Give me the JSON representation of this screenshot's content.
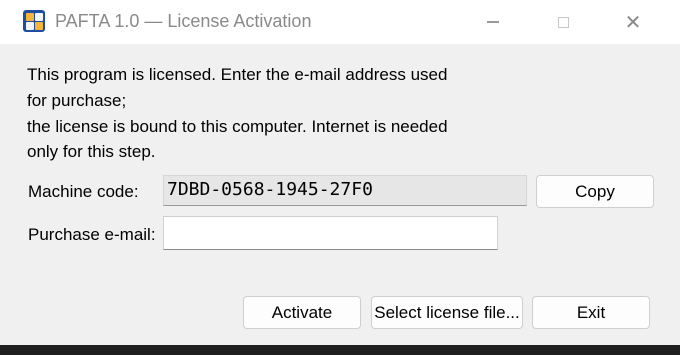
{
  "window": {
    "title": "PAFTA 1.0 — License Activation",
    "icon": "app-grid-icon"
  },
  "titlebar_controls": {
    "minimize_icon": "minimize-icon",
    "maximize_icon": "maximize-icon",
    "close_icon": "close-icon",
    "close_glyph": "✕"
  },
  "message": {
    "line1": "This program is licensed. Enter the e-mail address used",
    "line2": "for purchase;",
    "line3": "the license is bound to this computer. Internet is needed",
    "line4": "only for this step."
  },
  "machine_code": {
    "label": "Machine code:",
    "value": "7DBD-0568-1945-27F0",
    "copy_label": "Copy"
  },
  "email": {
    "label": "Purchase e-mail:",
    "value": "",
    "placeholder": ""
  },
  "actions": {
    "activate_label": "Activate",
    "select_file_label": "Select license file...",
    "exit_label": "Exit"
  }
}
